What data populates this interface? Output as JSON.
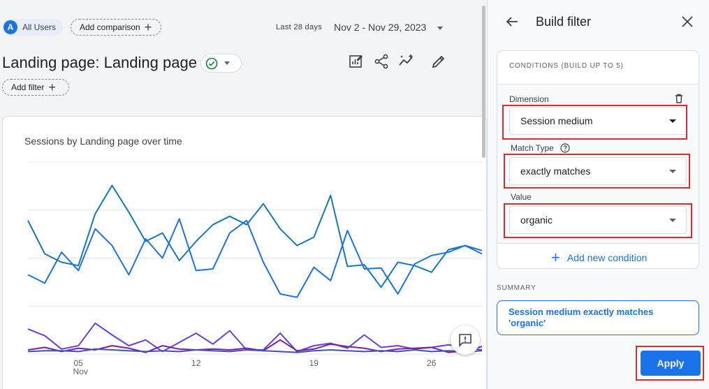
{
  "header": {
    "segment_avatar": "A",
    "segment_label": "All Users",
    "add_comparison_label": "Add comparison",
    "date_prefix": "Last 28 days",
    "date_range": "Nov 2 - Nov 29, 2023"
  },
  "report": {
    "title": "Landing page: Landing page",
    "add_filter_label": "Add filter"
  },
  "chart_data": {
    "type": "line",
    "title": "Sessions by Landing page over time",
    "x_tick_labels": [
      {
        "day": "05",
        "month": "Nov"
      },
      {
        "day": "12",
        "month": ""
      },
      {
        "day": "19",
        "month": ""
      },
      {
        "day": "26",
        "month": ""
      }
    ],
    "x": [
      2,
      3,
      4,
      5,
      6,
      7,
      8,
      9,
      10,
      11,
      12,
      13,
      14,
      15,
      16,
      17,
      18,
      19,
      20,
      21,
      22,
      23,
      24,
      25,
      26,
      27,
      28,
      29
    ],
    "series": [
      {
        "color": "#137ab5",
        "values": [
          160,
          120,
          110,
          106,
          168,
          202,
          170,
          135,
          145,
          112,
          135,
          155,
          165,
          155,
          180,
          150,
          130,
          140,
          190,
          105,
          107,
          80,
          110,
          106,
          98,
          125,
          130,
          124
        ]
      },
      {
        "color": "#1a73e8",
        "values": [
          95,
          85,
          122,
          100,
          150,
          130,
          95,
          138,
          115,
          162,
          100,
          102,
          145,
          160,
          110,
          72,
          68,
          104,
          88,
          148,
          102,
          103,
          72,
          108,
          118,
          122,
          130,
          120
        ]
      },
      {
        "color": "#6741d9",
        "values": [
          30,
          22,
          6,
          10,
          37,
          23,
          10,
          17,
          3,
          14,
          25,
          12,
          28,
          5,
          5,
          25,
          3,
          10,
          13,
          7,
          23,
          8,
          10,
          6,
          8,
          11,
          8,
          5
        ]
      },
      {
        "color": "#7b1fa2",
        "values": [
          5,
          8,
          3,
          7,
          5,
          10,
          7,
          2,
          10,
          6,
          5,
          6,
          5,
          7,
          4,
          17,
          4,
          6,
          12,
          9,
          7,
          3,
          6,
          7,
          8,
          2,
          4,
          9
        ]
      },
      {
        "color": "#3f51b5",
        "values": [
          3,
          4,
          4,
          3,
          6,
          5,
          4,
          3,
          4,
          3,
          5,
          4,
          3,
          5,
          4,
          3,
          2,
          4,
          5,
          4,
          3,
          4,
          3,
          5,
          3,
          4,
          3,
          4
        ]
      }
    ],
    "ylim": [
      0,
      230
    ],
    "grid": true
  },
  "panel": {
    "title": "Build filter",
    "conditions_header": "CONDITIONS (BUILD UP TO 5)",
    "dimension_label": "Dimension",
    "dimension_value": "Session medium",
    "match_type_label": "Match Type",
    "match_type_value": "exactly matches",
    "value_label": "Value",
    "value_value": "organic",
    "add_condition_label": "Add new condition",
    "summary_header": "SUMMARY",
    "summary_text": "Session medium exactly matches 'organic'",
    "apply_label": "Apply"
  },
  "colors": {
    "accent": "#1a73e8",
    "highlight": "#d32f2f"
  }
}
